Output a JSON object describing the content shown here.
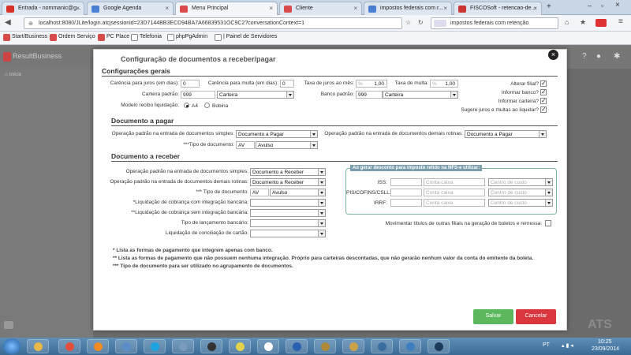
{
  "browser": {
    "tabs": [
      {
        "label": "Entrada - nommanic@g...",
        "icon": "gmail-icon",
        "color": "#d93025"
      },
      {
        "label": "Google Agenda",
        "icon": "calendar-icon",
        "color": "#4a7fd4"
      },
      {
        "label": "Menu Principal",
        "icon": "app-icon",
        "color": "#d94b4b"
      },
      {
        "label": "Cliente",
        "icon": "app-icon",
        "color": "#d94b4b"
      },
      {
        "label": "impostos federais com r...",
        "icon": "google-icon",
        "color": "#4a7fd4"
      },
      {
        "label": "FISCOSoft - retencao-de...",
        "icon": "fiscosoft-icon",
        "color": "#c33"
      }
    ],
    "url": "localhost:8080/JLite/login.atcjsessionid=23D7144BB3ECD94BA7A66839531OC9C2?conversationContext=1",
    "search_value": "impostos federais com retenção",
    "bookmarks": [
      "Start/Business",
      "Ordem Serviço",
      "PC Place",
      "Telefonia",
      "phpPgAdmin",
      "| Painel de Servidores"
    ]
  },
  "app": {
    "brand": "ResultBusiness",
    "home": "Início"
  },
  "modal": {
    "title": "Configuração de documentos a receber/pagar",
    "gerais": {
      "title": "Configurações gerais",
      "carencia_juros_label": "Carência para juros (em dias):",
      "carencia_juros_value": "0",
      "carencia_multa_label": "Carência para multa (em dias):",
      "carencia_multa_value": "0",
      "taxa_juros_label": "Taxa de juros ao mês:",
      "taxa_juros_prefix": "%",
      "taxa_juros_value": "1,00",
      "taxa_multa_label": "Taxa de multa:",
      "taxa_multa_prefix": "%",
      "taxa_multa_value": "1,00",
      "carteira_label": "Carteira padrão:",
      "carteira_code": "999",
      "carteira_name": "Carteira",
      "banco_label": "Banco padrão:",
      "banco_code": "999",
      "banco_name": "Carteira",
      "modelo_label": "Modelo recibo liquidação:",
      "modelo_a4": "A4",
      "modelo_bobina": "Bobina",
      "alterar_filial": "Alterar filial?",
      "informar_banco": "Informar banco?",
      "informar_carteira": "Informar carteira?",
      "sugere_juros": "Sugere juros e multas ao liquidar?"
    },
    "pagar": {
      "title": "Documento a pagar",
      "op_simples_label": "Operação padrão na entrada de documentos simples:",
      "op_simples_value": "Documento a Pagar",
      "op_demais_label": "Operação padrão na entrada de documentos demais rotinas:",
      "op_demais_value": "Documento a Pagar",
      "tipo_label": "***Tipo de documento:",
      "tipo_code": "AV",
      "tipo_name": "Avulso"
    },
    "receber": {
      "title": "Documento a receber",
      "op_simples_label": "Operação padrão na entrada de documentos simples:",
      "op_simples_value": "Documento a Receber",
      "op_demais_label": "Operação padrão na entrada de documentos demais rotinas:",
      "op_demais_value": "Documento a Receber",
      "tipo_label": "*** Tipo de documento:",
      "tipo_code": "AV",
      "tipo_name": "Avulso",
      "liq_com_label": "*Liquidação de cobrança com integração bancária:",
      "liq_sem_label": "**Liquidação de cobrança sem integração bancária:",
      "tipo_lanc_label": "Tipo de lançamento bancário:",
      "liq_cartao_label": "Liquidação de conciliação de cartão:",
      "nfs_title": "Ao gerar desconto para imposto retido na NFS-e utilizar:",
      "iss_label": "ISS:",
      "pis_label": "PIS/COFINS/CSLL:",
      "irrf_label": "IRRF:",
      "conta_caixa_ph": "Conta caixa",
      "centro_custo_ph": "Centro de custo",
      "movimentar_label": "Movimentar títulos de outras filiais na geração de boletos e remessa:"
    },
    "notes": [
      "* Lista as formas de pagamento que integrem apenas com banco.",
      "** Lista as formas de pagamento que não possuem nenhuma integração. Próprio para carteiras descontadas, que não gerarão nenhum valor da conta do emitente da boleta.",
      "*** Tipo de documento para ser utilizado no agrupamento de documentos."
    ],
    "save_label": "Salvar",
    "cancel_label": "Cancelar"
  },
  "taskbar": {
    "lang": "PT",
    "time": "10:25",
    "date": "23/09/2014",
    "footer_brand": "ATS"
  }
}
